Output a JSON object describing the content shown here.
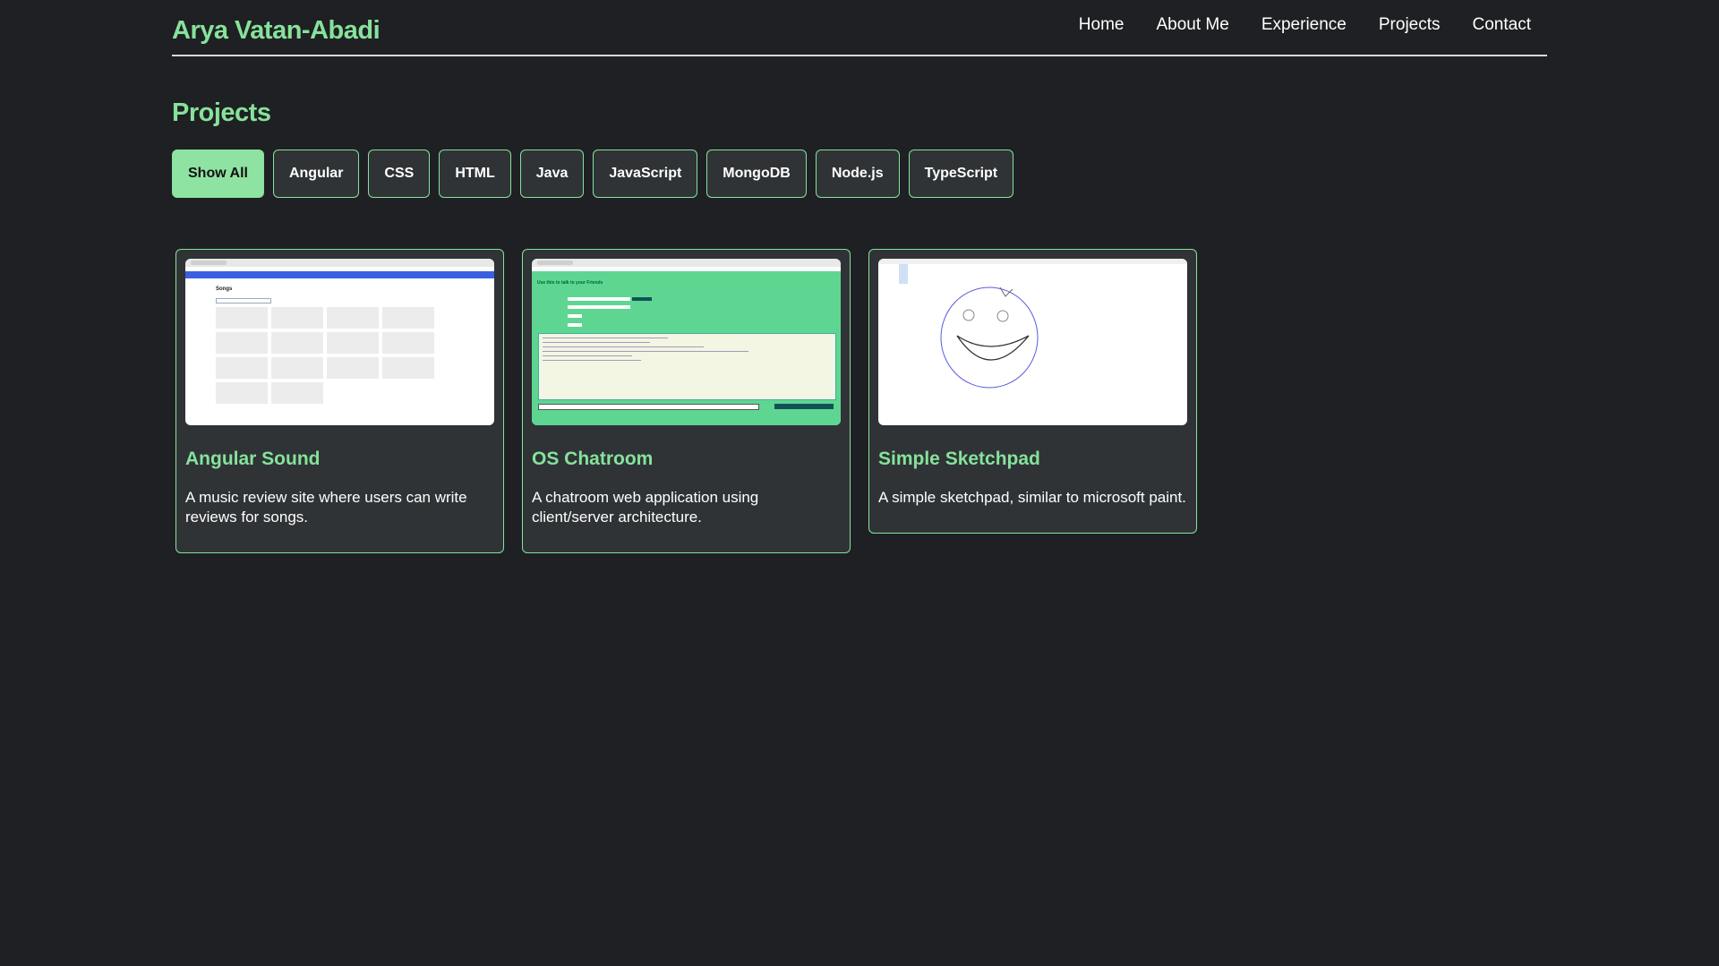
{
  "header": {
    "brand": "Arya Vatan-Abadi",
    "nav": [
      "Home",
      "About Me",
      "Experience",
      "Projects",
      "Contact"
    ]
  },
  "page_title": "Projects",
  "filters": {
    "items": [
      "Show All",
      "Angular",
      "CSS",
      "HTML",
      "Java",
      "JavaScript",
      "MongoDB",
      "Node.js",
      "TypeScript"
    ],
    "active": "Show All"
  },
  "projects": [
    {
      "title": "Angular Sound",
      "description": "A music review site where users can write reviews for songs.",
      "thumbnail": "songs-list-screenshot"
    },
    {
      "title": "OS Chatroom",
      "description": "A chatroom web application using client/server architecture.",
      "thumbnail": "chatroom-screenshot"
    },
    {
      "title": "Simple Sketchpad",
      "description": "A simple sketchpad, similar to microsoft paint.",
      "thumbnail": "smiley-sketch-screenshot"
    }
  ],
  "thumb_text": {
    "songs": "Songs",
    "chat": "Use this to talk to your Friends"
  },
  "colors": {
    "background": "#1f2023",
    "accent": "#86e29b",
    "card": "#2f3336",
    "active_filter": "#8fe3a2"
  }
}
